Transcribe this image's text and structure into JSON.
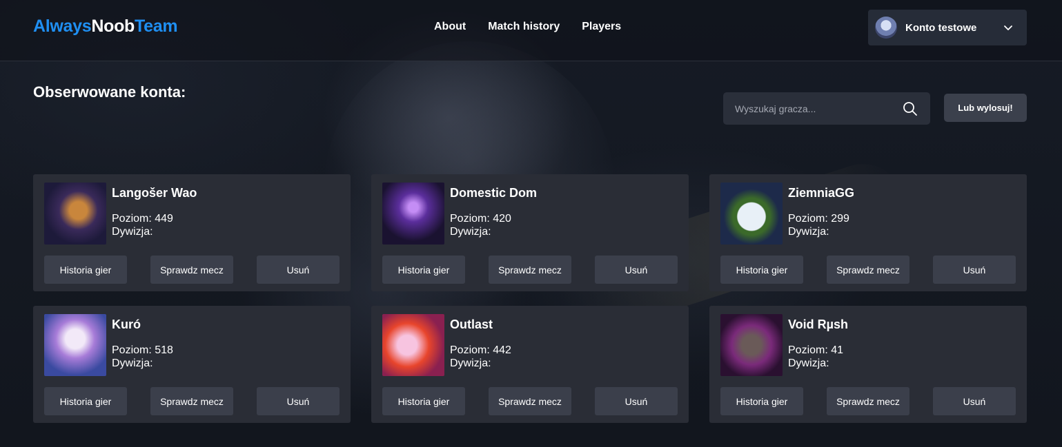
{
  "brand": {
    "part1": "Always",
    "part2": "Noob",
    "part3": "Team"
  },
  "nav": {
    "items": [
      {
        "label": "About"
      },
      {
        "label": "Match history"
      },
      {
        "label": "Players"
      }
    ]
  },
  "account": {
    "name": "Konto testowe"
  },
  "main": {
    "title": "Obserwowane konta:",
    "search_placeholder": "Wyszukaj gracza...",
    "random_label": "Lub wylosuj!"
  },
  "labels": {
    "history": "Historia gier",
    "check_match": "Sprawdz mecz",
    "remove": "Usuń",
    "level_prefix": "Poziom:",
    "division_prefix": "Dywizja:"
  },
  "players": [
    {
      "name": "Langošer Wao",
      "level": "449",
      "division": ""
    },
    {
      "name": "Domestic Dom",
      "level": "420",
      "division": ""
    },
    {
      "name": "ZiemniaGG",
      "level": "299",
      "division": ""
    },
    {
      "name": "Kuró",
      "level": "518",
      "division": ""
    },
    {
      "name": "Outlast",
      "level": "442",
      "division": ""
    },
    {
      "name": "Void Rµsh",
      "level": "41",
      "division": ""
    }
  ],
  "colors": {
    "brand_blue": "#1f8ff2",
    "card_bg": "#2a2d36",
    "button_bg": "#3b3f4b"
  }
}
